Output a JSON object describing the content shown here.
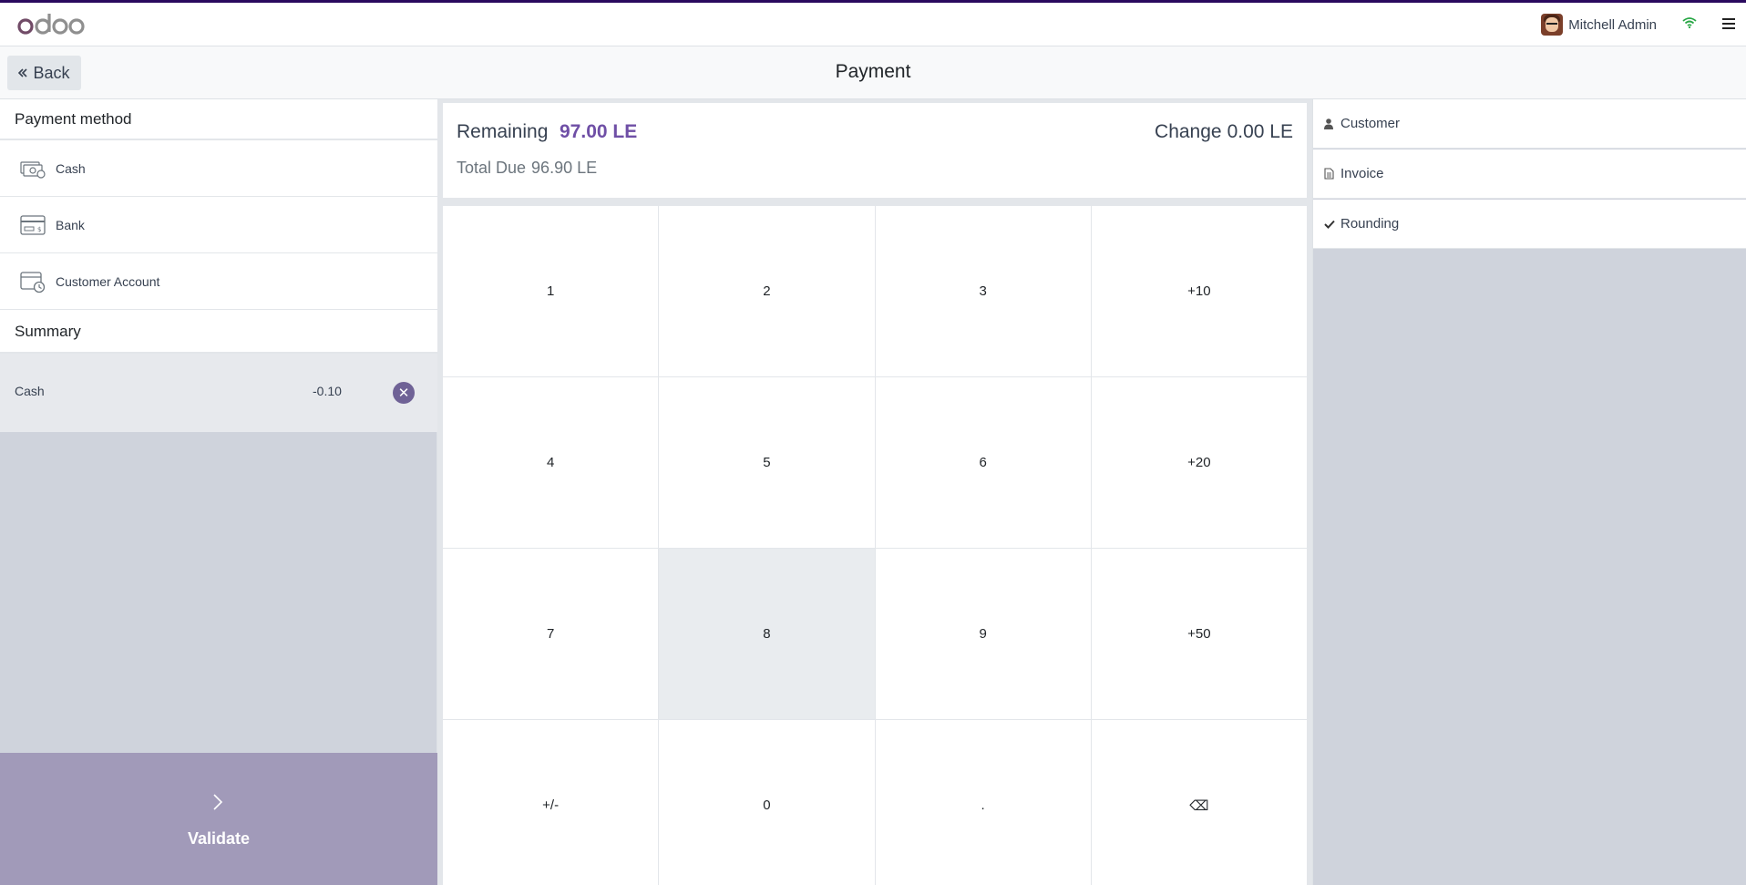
{
  "navbar": {
    "logo_text": "odoo",
    "user_name": "Mitchell Admin",
    "icons": [
      "avatar",
      "wifi-icon",
      "menu-icon"
    ]
  },
  "control": {
    "back_label": "Back",
    "page_title": "Payment"
  },
  "payment_methods": {
    "heading": "Payment method",
    "items": [
      {
        "label": "Cash",
        "icon": "cash-icon"
      },
      {
        "label": "Bank",
        "icon": "bank-card-icon"
      },
      {
        "label": "Customer Account",
        "icon": "customer-account-icon"
      }
    ]
  },
  "summary": {
    "heading": "Summary",
    "lines": [
      {
        "method": "Cash",
        "amount": "-0.10",
        "icon": "delete-circle-icon"
      }
    ]
  },
  "validate": {
    "label": "Validate",
    "icon": "chevron-right-icon"
  },
  "status": {
    "remaining_label": "Remaining",
    "remaining_value": "97.00 LE",
    "change_label": "Change",
    "change_value": "0.00 LE",
    "total_due_label": "Total Due",
    "total_due_value": "96.90 LE"
  },
  "numpad": {
    "keys": [
      "1",
      "2",
      "3",
      "+10",
      "4",
      "5",
      "6",
      "+20",
      "7",
      "8",
      "9",
      "+50",
      "+/-",
      "0",
      ".",
      "⌫"
    ],
    "pressed_key": "8"
  },
  "right_panel": {
    "buttons": [
      {
        "label": "Customer",
        "icon": "user-icon"
      },
      {
        "label": "Invoice",
        "icon": "document-icon"
      },
      {
        "label": "Rounding",
        "icon": "check-icon"
      }
    ]
  },
  "colors": {
    "brand_purple": "#714b67",
    "accent_purple": "#6f4fa6",
    "validate_bg": "#a19ab9",
    "topstrip": "#2a0a5e"
  }
}
